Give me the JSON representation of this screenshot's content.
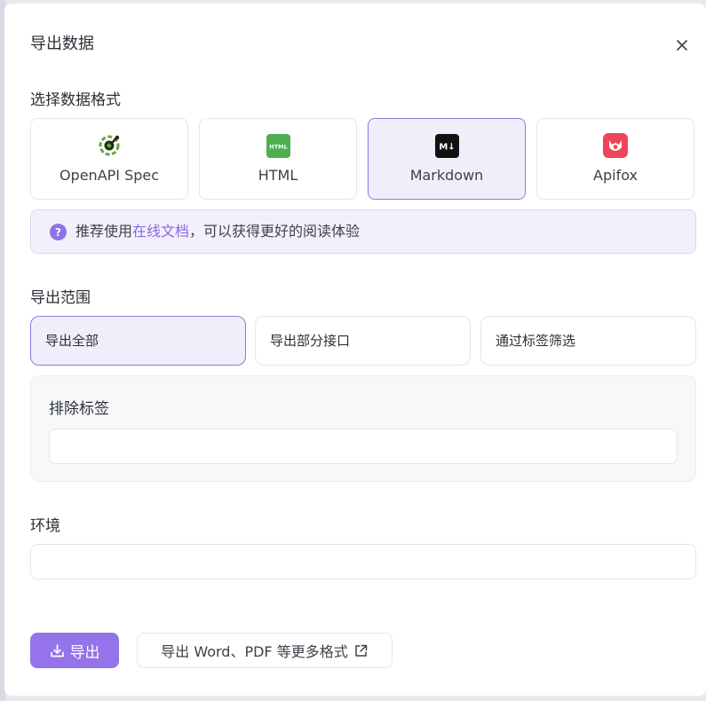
{
  "dialog": {
    "title": "导出数据",
    "close_icon": "close-icon"
  },
  "format_section": {
    "label": "选择数据格式",
    "options": [
      {
        "label": "OpenAPI Spec",
        "icon": "openapi-logo-icon",
        "selected": false
      },
      {
        "label": "HTML",
        "icon": "html-icon",
        "icon_text": "HTML",
        "icon_color": "#4caf50",
        "selected": false
      },
      {
        "label": "Markdown",
        "icon": "markdown-icon",
        "icon_text": "M↓",
        "icon_color": "#111111",
        "selected": true
      },
      {
        "label": "Apifox",
        "icon": "apifox-logo-icon",
        "icon_color": "#f0445a",
        "selected": false
      }
    ]
  },
  "tip": {
    "icon": "question-circle-icon",
    "prefix": "推荐使用",
    "link": "在线文档",
    "suffix": "，可以获得更好的阅读体验"
  },
  "range_section": {
    "label": "导出范围",
    "options": [
      {
        "label": "导出全部",
        "selected": true
      },
      {
        "label": "导出部分接口",
        "selected": false
      },
      {
        "label": "通过标签筛选",
        "selected": false
      }
    ]
  },
  "exclude_tags": {
    "label": "排除标签",
    "value": "",
    "placeholder": ""
  },
  "environment": {
    "label": "环境",
    "value": "",
    "placeholder": ""
  },
  "footer": {
    "export_label": "导出",
    "export_icon": "download-icon",
    "more_label": "导出 Word、PDF 等更多格式",
    "more_icon": "external-link-icon"
  },
  "colors": {
    "accent": "#9573ea",
    "accent_text": "#8367e6",
    "selected_bg": "#f1eefc",
    "selected_border": "#8c79e0"
  }
}
